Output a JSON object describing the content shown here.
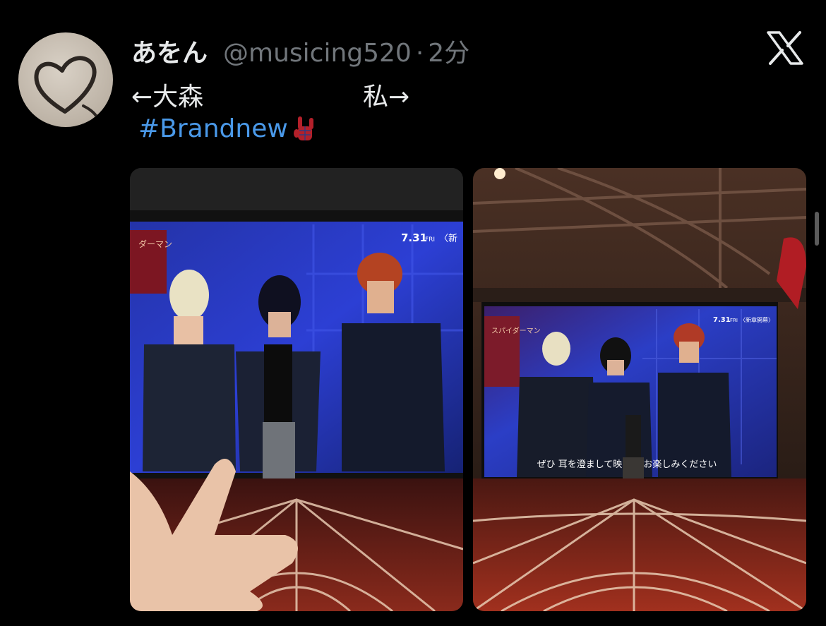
{
  "tweet": {
    "display_name": "あをん",
    "handle": "@musicing520",
    "separator": "·",
    "time": "2分",
    "line_left": "←大森",
    "line_right": "私→",
    "hashtag": "#Brandnew",
    "emoji_name": "sign-of-horns-emoji"
  },
  "photos": {
    "left": {
      "date_badge": "7.31",
      "date_suffix": "FRI",
      "date_tail": "〈新"
    },
    "right": {
      "date_badge": "7.31",
      "date_suffix": "FRI",
      "date_tail": "〈新章開幕〉",
      "subtitle": "ぜひ 耳を澄まして映画    をお楽しみください"
    }
  },
  "colors": {
    "background": "#000000",
    "text": "#e7e9ea",
    "muted": "#71767b",
    "link": "#4a99e9"
  },
  "icons": {
    "brand": "x-logo-icon",
    "avatar_graphic": "heart-doodle"
  }
}
